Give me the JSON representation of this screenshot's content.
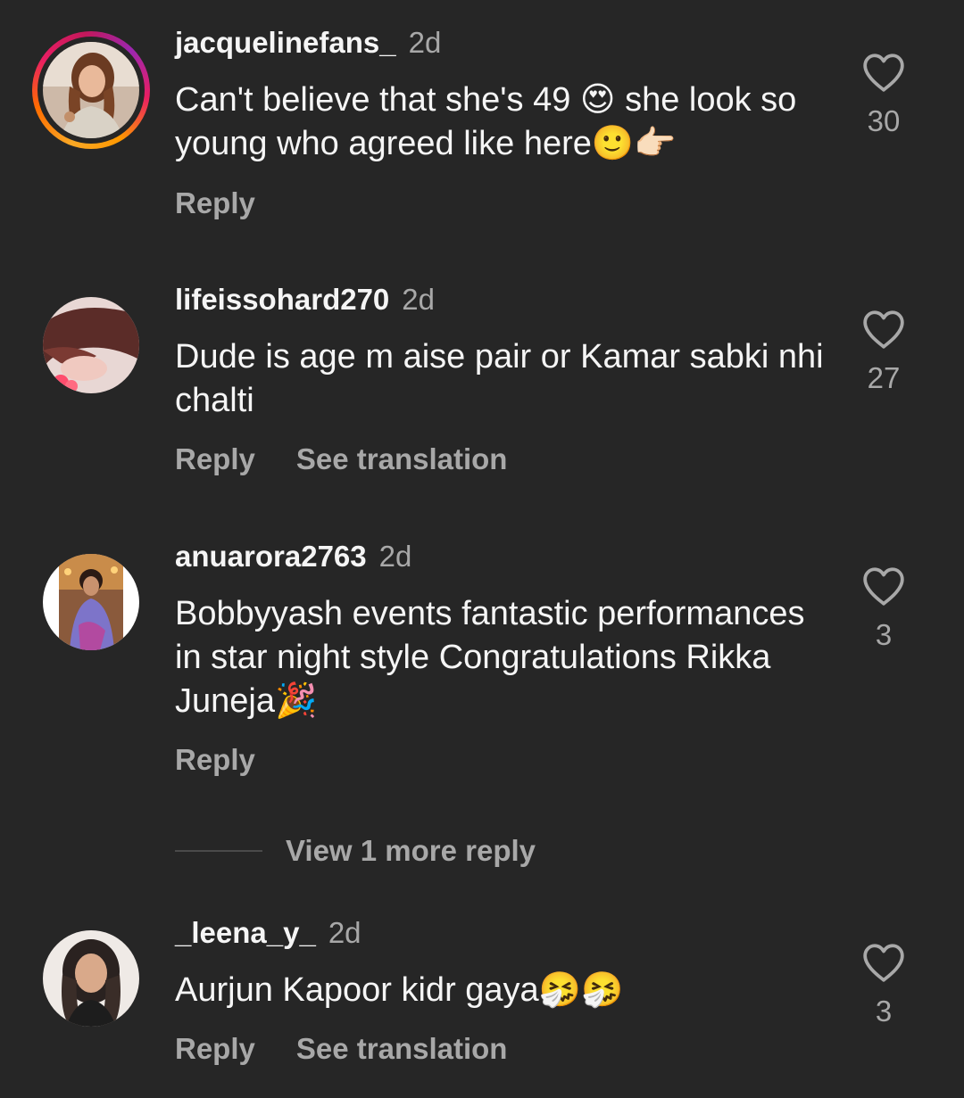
{
  "comments": [
    {
      "username": "jacquelinefans_",
      "time": "2d",
      "text": "Can't believe that she's 49 😍 she look so young who agreed like here🙂👉🏻",
      "likes": "30",
      "actions": [
        "Reply"
      ],
      "avatar_icon": "woman-portrait-avatar",
      "has_story": true
    },
    {
      "username": "lifeissohard270",
      "time": "2d",
      "text": "Dude is age m aise pair or Kamar sabki nhi chalti",
      "likes": "27",
      "actions": [
        "Reply",
        "See translation"
      ],
      "avatar_icon": "girl-with-flower-avatar",
      "has_story": false
    },
    {
      "username": "anuarora2763",
      "time": "2d",
      "text": "Bobbyyash events fantastic performances in star night style Congratulations Rikka Juneja🎉",
      "likes": "3",
      "actions": [
        "Reply"
      ],
      "avatar_icon": "woman-in-saree-avatar",
      "has_story": false
    },
    {
      "username": "_leena_y_",
      "time": "2d",
      "text": "Aurjun Kapoor kidr gaya🤧🤧",
      "likes": "3",
      "actions": [
        "Reply",
        "See translation"
      ],
      "avatar_icon": "woman-selfie-avatar",
      "has_story": false
    }
  ],
  "view_more": "View 1 more reply",
  "icons": {
    "like": "heart-outline-icon"
  },
  "colors": {
    "background": "#262626",
    "primary_text": "#f5f5f5",
    "secondary_text": "#a8a8a8",
    "story_ring": [
      "#f9a825",
      "#e91e63",
      "#9c27b0"
    ]
  }
}
